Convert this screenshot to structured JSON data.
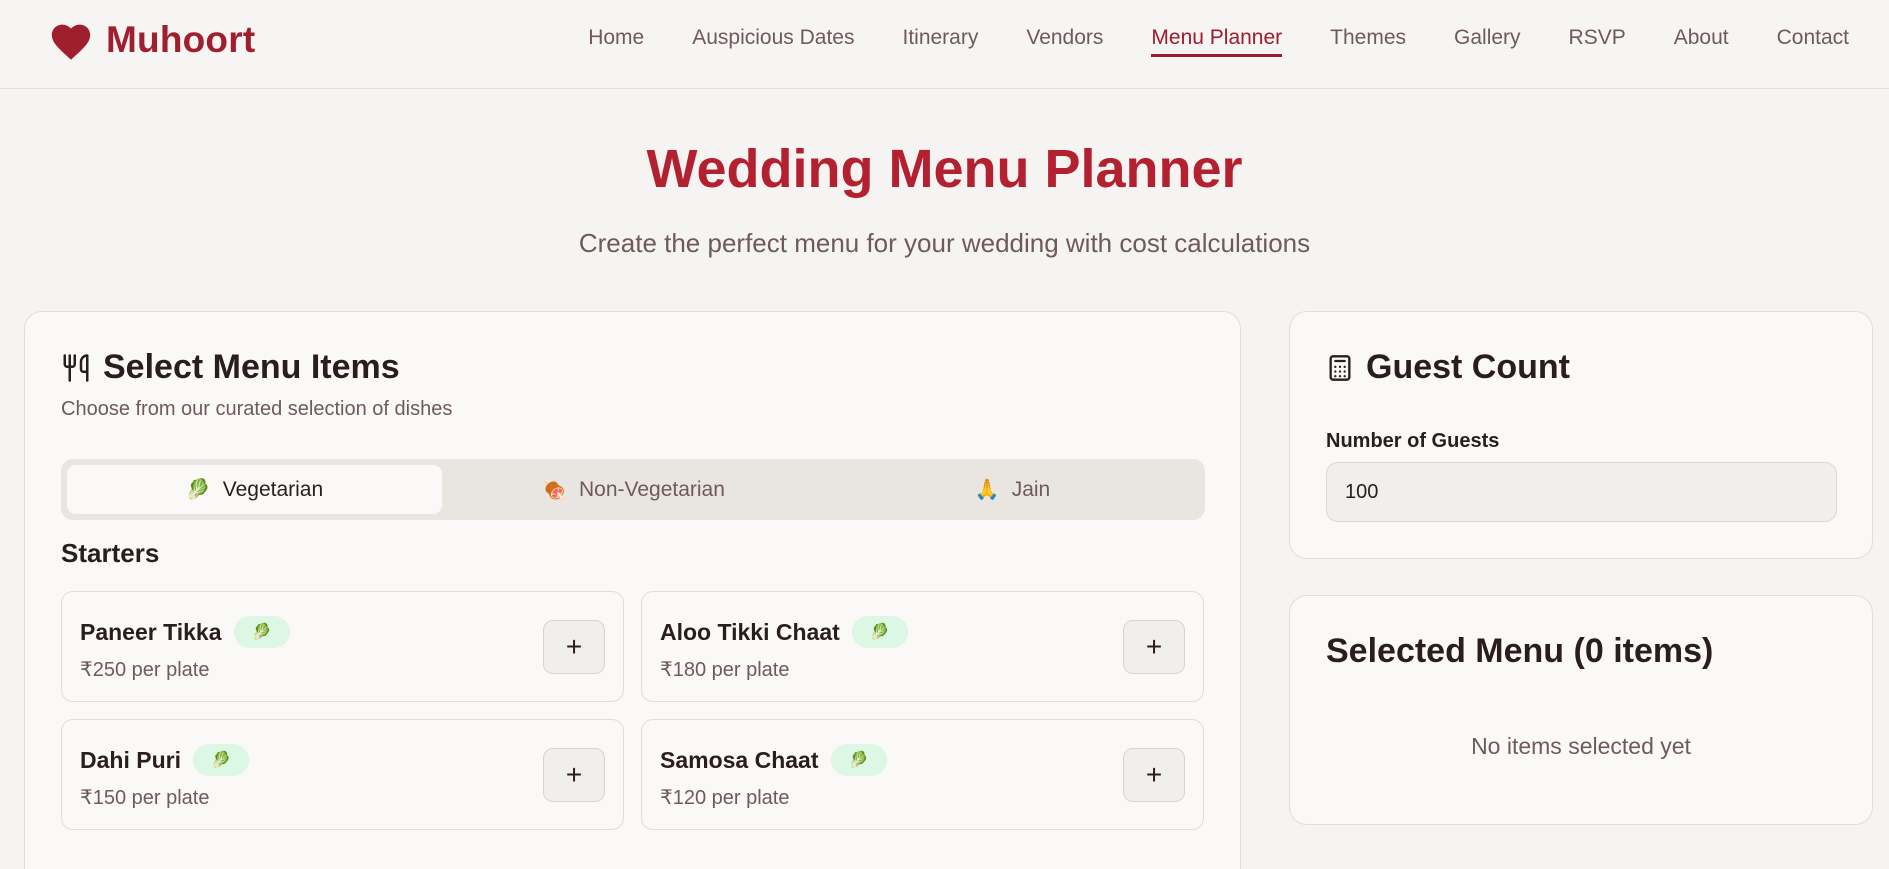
{
  "brand": {
    "name": "Muhoort",
    "icon": "heart-icon",
    "color": "#a01f2e"
  },
  "nav": {
    "items": [
      {
        "label": "Home",
        "active": false
      },
      {
        "label": "Auspicious Dates",
        "active": false
      },
      {
        "label": "Itinerary",
        "active": false
      },
      {
        "label": "Vendors",
        "active": false
      },
      {
        "label": "Menu Planner",
        "active": true
      },
      {
        "label": "Themes",
        "active": false
      },
      {
        "label": "Gallery",
        "active": false
      },
      {
        "label": "RSVP",
        "active": false
      },
      {
        "label": "About",
        "active": false
      },
      {
        "label": "Contact",
        "active": false
      }
    ]
  },
  "hero": {
    "title": "Wedding Menu Planner",
    "subtitle": "Create the perfect menu for your wedding with cost calculations"
  },
  "menu": {
    "title": "Select Menu Items",
    "icon": "utensils-icon",
    "description": "Choose from our curated selection of dishes",
    "tabs": [
      {
        "label": "Vegetarian",
        "emoji": "🥬",
        "active": true
      },
      {
        "label": "Non-Vegetarian",
        "emoji": "🍖",
        "active": false
      },
      {
        "label": "Jain",
        "emoji": "🙏",
        "active": false
      }
    ],
    "section": "Starters",
    "items": [
      {
        "name": "Paneer Tikka",
        "badge": "🥬",
        "price": "₹250 per plate",
        "add": "+"
      },
      {
        "name": "Aloo Tikki Chaat",
        "badge": "🥬",
        "price": "₹180 per plate",
        "add": "+"
      },
      {
        "name": "Dahi Puri",
        "badge": "🥬",
        "price": "₹150 per plate",
        "add": "+"
      },
      {
        "name": "Samosa Chaat",
        "badge": "🥬",
        "price": "₹120 per plate",
        "add": "+"
      }
    ]
  },
  "guests": {
    "title": "Guest Count",
    "icon": "calculator-icon",
    "label": "Number of Guests",
    "value": "100"
  },
  "selected": {
    "title": "Selected Menu (0 items)",
    "empty": "No items selected yet"
  },
  "colors": {
    "accent": "#b3202f",
    "background": "#f6f4f2",
    "veg_badge": "#dcf7e3"
  }
}
